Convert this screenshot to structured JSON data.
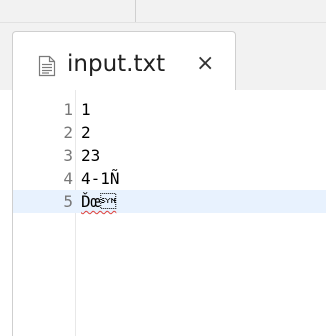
{
  "tab": {
    "title": "input.txt",
    "close_glyph": "×"
  },
  "editor": {
    "current_line": 5,
    "lines": [
      {
        "number": "1",
        "text": "1"
      },
      {
        "number": "2",
        "text": "2"
      },
      {
        "number": "3",
        "text": "23"
      },
      {
        "number": "4",
        "text": "4-1Ñ"
      },
      {
        "number": "5",
        "text": "Ďœ\u0016"
      }
    ]
  },
  "colors": {
    "current_line_highlight": "#e8f2fe",
    "line_number": "#787878",
    "error_squiggle": "#e0403a"
  }
}
